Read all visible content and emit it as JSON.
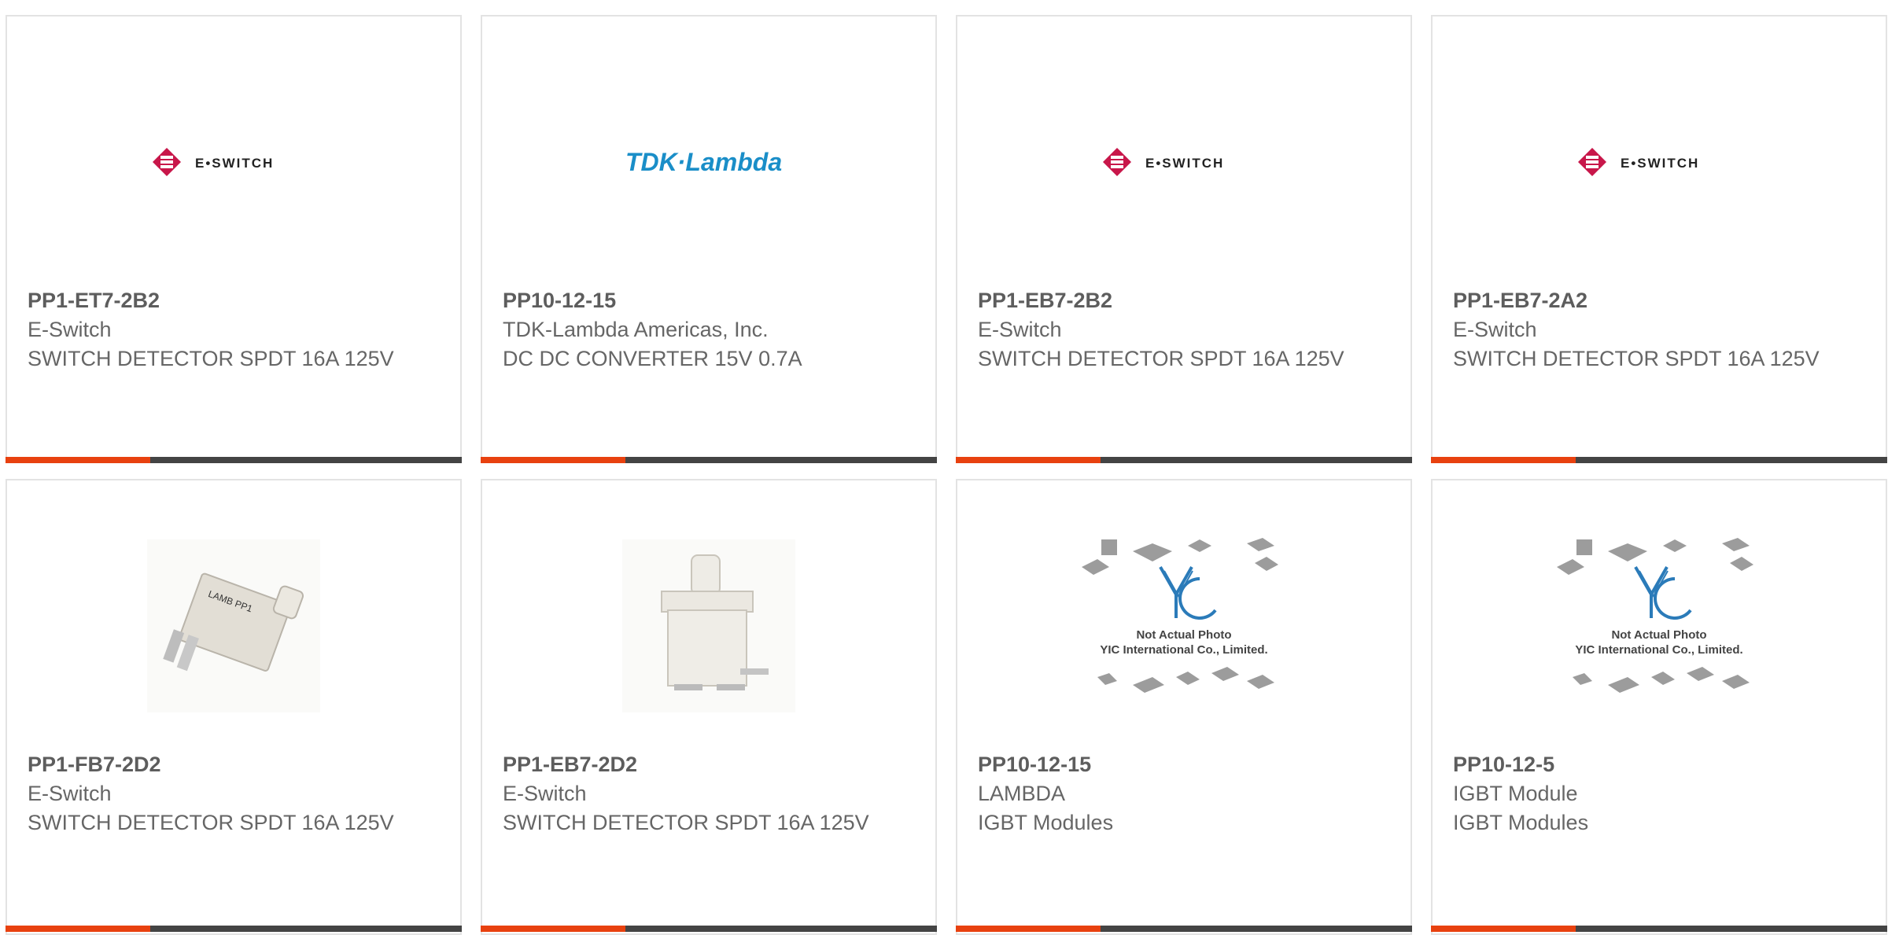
{
  "colors": {
    "accent": "#e8410f",
    "bar": "#444444",
    "text": "#666666",
    "border": "#e3e3e3"
  },
  "products": [
    {
      "part": "PP1-ET7-2B2",
      "maker": "E-Switch",
      "desc": "SWITCH DETECTOR SPDT 16A 125V",
      "image": "eswitch-logo",
      "logo_text": "E•SWITCH"
    },
    {
      "part": "PP10-12-15",
      "maker": "TDK-Lambda Americas, Inc.",
      "desc": "DC DC CONVERTER 15V 0.7A",
      "image": "tdk-lambda-logo",
      "logo_text": "TDK·Lambda"
    },
    {
      "part": "PP1-EB7-2B2",
      "maker": "E-Switch",
      "desc": "SWITCH DETECTOR SPDT 16A 125V",
      "image": "eswitch-logo",
      "logo_text": "E•SWITCH"
    },
    {
      "part": "PP1-EB7-2A2",
      "maker": "E-Switch",
      "desc": "SWITCH DETECTOR SPDT 16A 125V",
      "image": "eswitch-logo",
      "logo_text": "E•SWITCH"
    },
    {
      "part": "PP1-FB7-2D2",
      "maker": "E-Switch",
      "desc": "SWITCH DETECTOR SPDT 16A 125V",
      "image": "switch-photo-angled"
    },
    {
      "part": "PP1-EB7-2D2",
      "maker": "E-Switch",
      "desc": "SWITCH DETECTOR SPDT 16A 125V",
      "image": "switch-photo-front"
    },
    {
      "part": "PP10-12-15",
      "maker": "LAMBDA",
      "desc": "IGBT Modules",
      "image": "yic-placeholder",
      "placeholder_line1": "Not Actual Photo",
      "placeholder_line2": "YIC International Co., Limited."
    },
    {
      "part": "PP10-12-5",
      "maker": "IGBT Module",
      "desc": "IGBT Modules",
      "image": "yic-placeholder",
      "placeholder_line1": "Not Actual Photo",
      "placeholder_line2": "YIC International Co., Limited."
    }
  ]
}
